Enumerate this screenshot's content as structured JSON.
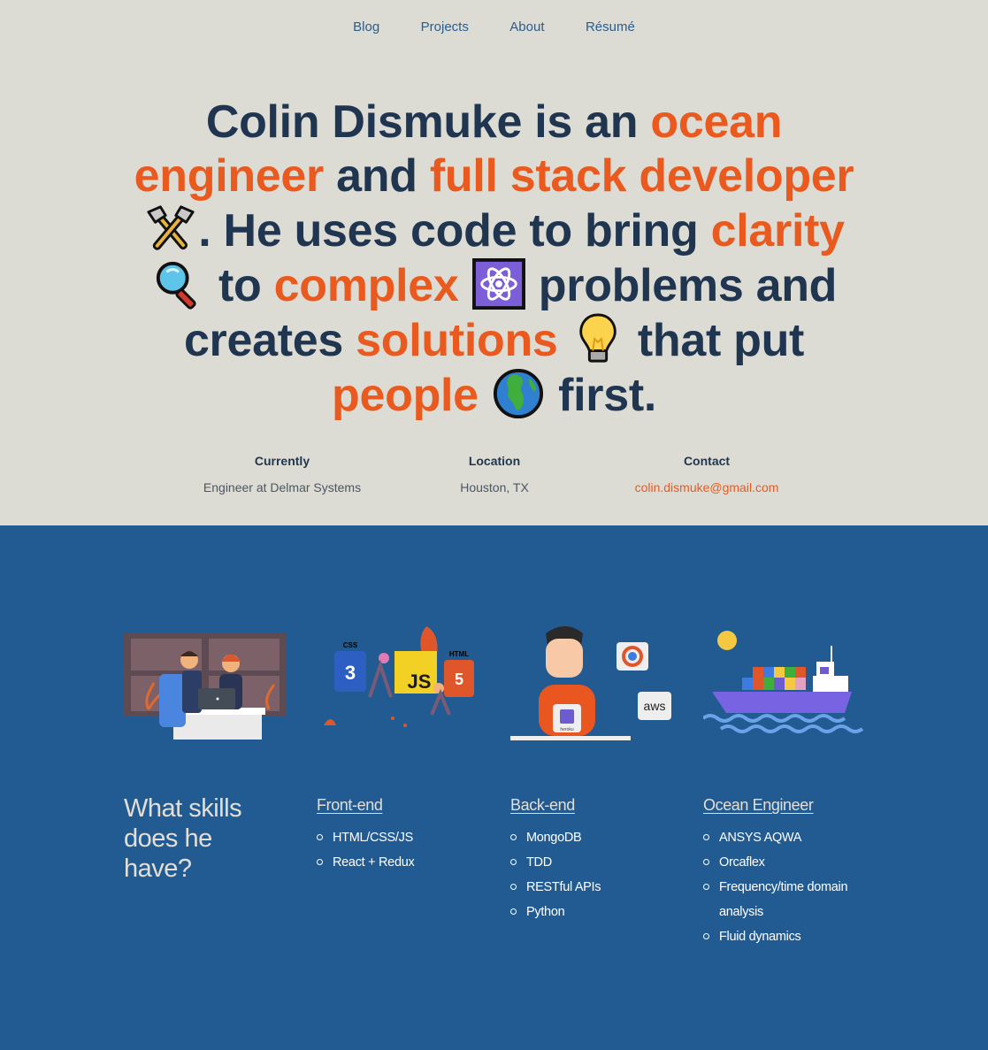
{
  "nav": {
    "items": [
      {
        "label": "Blog"
      },
      {
        "label": "Projects"
      },
      {
        "label": "About"
      },
      {
        "label": "Résumé"
      }
    ]
  },
  "headline": {
    "p1": "Colin Dismuke is an ",
    "h1": "ocean engineer",
    "p2": " and ",
    "h2": "full stack developer",
    "p3": ". He uses code to bring ",
    "h3": "clarity",
    "p4": " to ",
    "h4": "complex",
    "p5": " problems and creates ",
    "h5": "solutions",
    "p6": " that put ",
    "h6": "people",
    "p7": " first.",
    "icons": [
      "hammer-pick-icon",
      "magnifying-glass-icon",
      "atom-icon",
      "light-bulb-icon",
      "globe-icon"
    ]
  },
  "info": {
    "currently": {
      "label": "Currently",
      "value": "Engineer at Delmar Systems"
    },
    "location": {
      "label": "Location",
      "value": "Houston, TX"
    },
    "contact": {
      "label": "Contact",
      "value": "colin.dismuke@gmail.com"
    }
  },
  "colors": {
    "background": "#dddcd4",
    "accent": "#ea5a1f",
    "text": "#1f3550",
    "skills_bg": "#225b92"
  },
  "skills": {
    "question": "What skills does he have?",
    "frontend": {
      "title": "Front-end",
      "items": [
        "HTML/CSS/JS",
        "React + Redux"
      ]
    },
    "backend": {
      "title": "Back-end",
      "items": [
        "MongoDB",
        "TDD",
        "RESTful APIs",
        "Python"
      ]
    },
    "ocean": {
      "title": "Ocean Engineer",
      "items": [
        "ANSYS AQWA",
        "Orcaflex",
        "Frequency/time domain analysis",
        "Fluid dynamics"
      ]
    },
    "illustration_labels": {
      "css": "CSS",
      "js": "JS",
      "html": "HTML",
      "heroku": "heroku",
      "aws": "aws"
    }
  }
}
